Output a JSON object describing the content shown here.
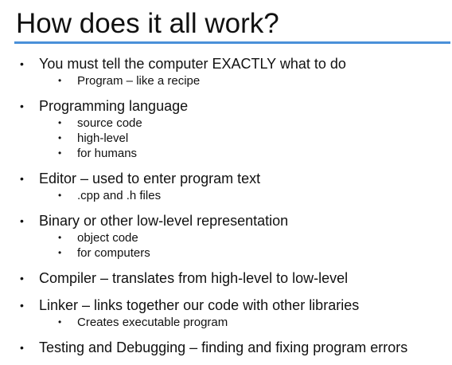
{
  "slide": {
    "title": "How does it all work?",
    "bullet_glyph": "•",
    "accent_color": "#4a90d9",
    "items": [
      {
        "text": "You must tell the computer EXACTLY what to do",
        "subs": [
          "Program – like a recipe"
        ]
      },
      {
        "text": "Programming language",
        "subs": [
          "source code",
          "high-level",
          "for humans"
        ]
      },
      {
        "text": "Editor – used to enter program text",
        "subs": [
          ".cpp and .h files"
        ]
      },
      {
        "text": "Binary or other low-level representation",
        "subs": [
          "object code",
          "for computers"
        ]
      },
      {
        "text": "Compiler – translates from high-level to low-level",
        "subs": []
      },
      {
        "text": "Linker – links together our code with other libraries",
        "subs": [
          "Creates executable program"
        ]
      },
      {
        "text": "Testing and Debugging – finding and fixing program errors",
        "subs": []
      }
    ]
  }
}
